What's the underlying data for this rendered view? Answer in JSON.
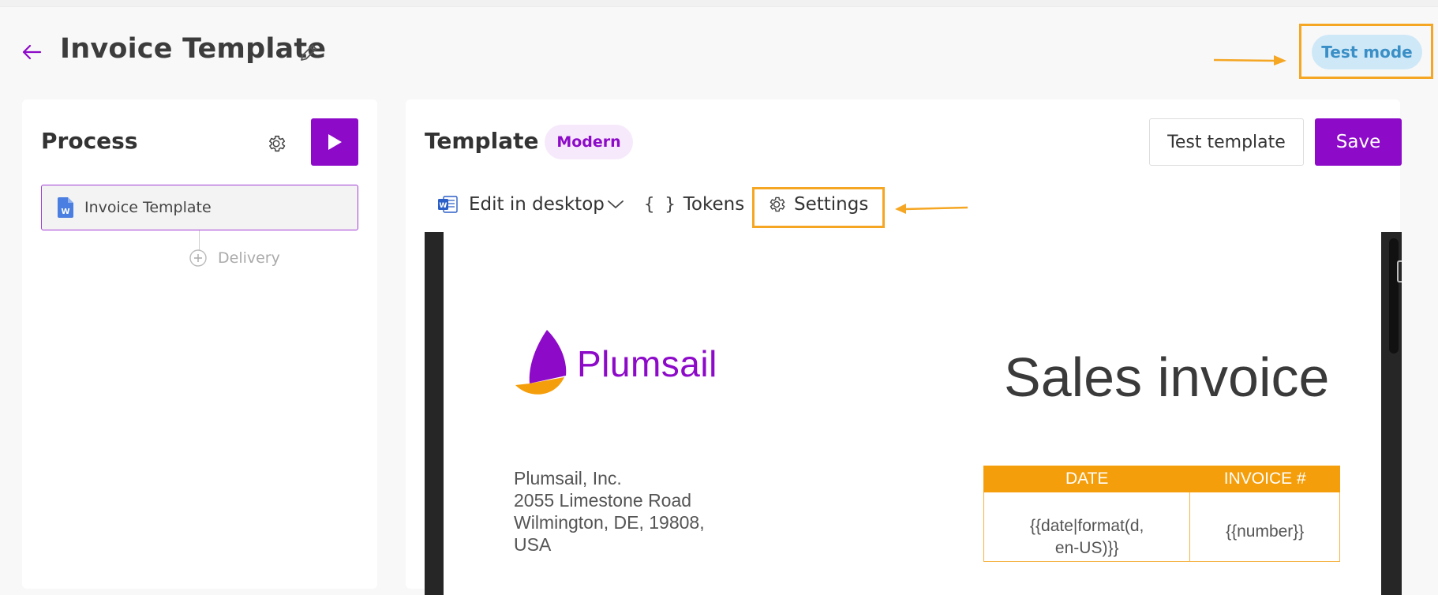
{
  "header": {
    "title": "Invoice Template",
    "test_mode_label": "Test mode"
  },
  "process": {
    "title": "Process",
    "items": [
      {
        "label": "Invoice Template"
      }
    ],
    "delivery_label": "Delivery"
  },
  "template": {
    "title": "Template",
    "style_badge": "Modern",
    "test_button_label": "Test template",
    "save_button_label": "Save",
    "toolbar": {
      "edit_label": "Edit in desktop",
      "tokens_label": "Tokens",
      "settings_label": "Settings"
    }
  },
  "document": {
    "logo_text": "Plumsail",
    "title": "Sales invoice",
    "address_lines": [
      "Plumsail, Inc.",
      "2055 Limestone Road",
      "Wilmington, DE, 19808,",
      "USA"
    ],
    "table": {
      "headers": [
        "DATE",
        "INVOICE #"
      ],
      "cells": [
        "{{date|format(d, en-US)}}",
        "{{number}}"
      ],
      "cell0_line1": "{{date|format(d,",
      "cell0_line2": "en-US)}}"
    }
  },
  "colors": {
    "brand_purple": "#8d0ac9",
    "highlight_orange": "#f5a623",
    "test_mode_bg": "#cfe8f7",
    "table_header": "#f59e0b"
  },
  "icons": [
    "back-arrow-icon",
    "pencil-icon",
    "gear-icon",
    "play-icon",
    "word-doc-icon",
    "plus-circle-icon",
    "chevron-down-icon",
    "braces-icon"
  ]
}
